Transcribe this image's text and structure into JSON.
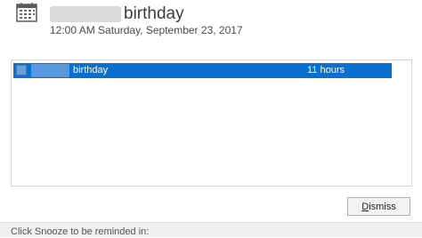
{
  "header": {
    "title": "birthday",
    "datetime": "12:00 AM Saturday, September 23, 2017",
    "icon": "calendar-icon"
  },
  "reminders": [
    {
      "subject": "birthday",
      "due_in": "11 hours",
      "selected": true,
      "icon": "appointment-icon"
    }
  ],
  "buttons": {
    "dismiss_prefix": "D",
    "dismiss_rest": "ismiss"
  },
  "footer": {
    "snooze_prompt": "Click Snooze to be reminded in:"
  },
  "colors": {
    "selection": "#0a6fcf",
    "background": "#ffffff"
  }
}
